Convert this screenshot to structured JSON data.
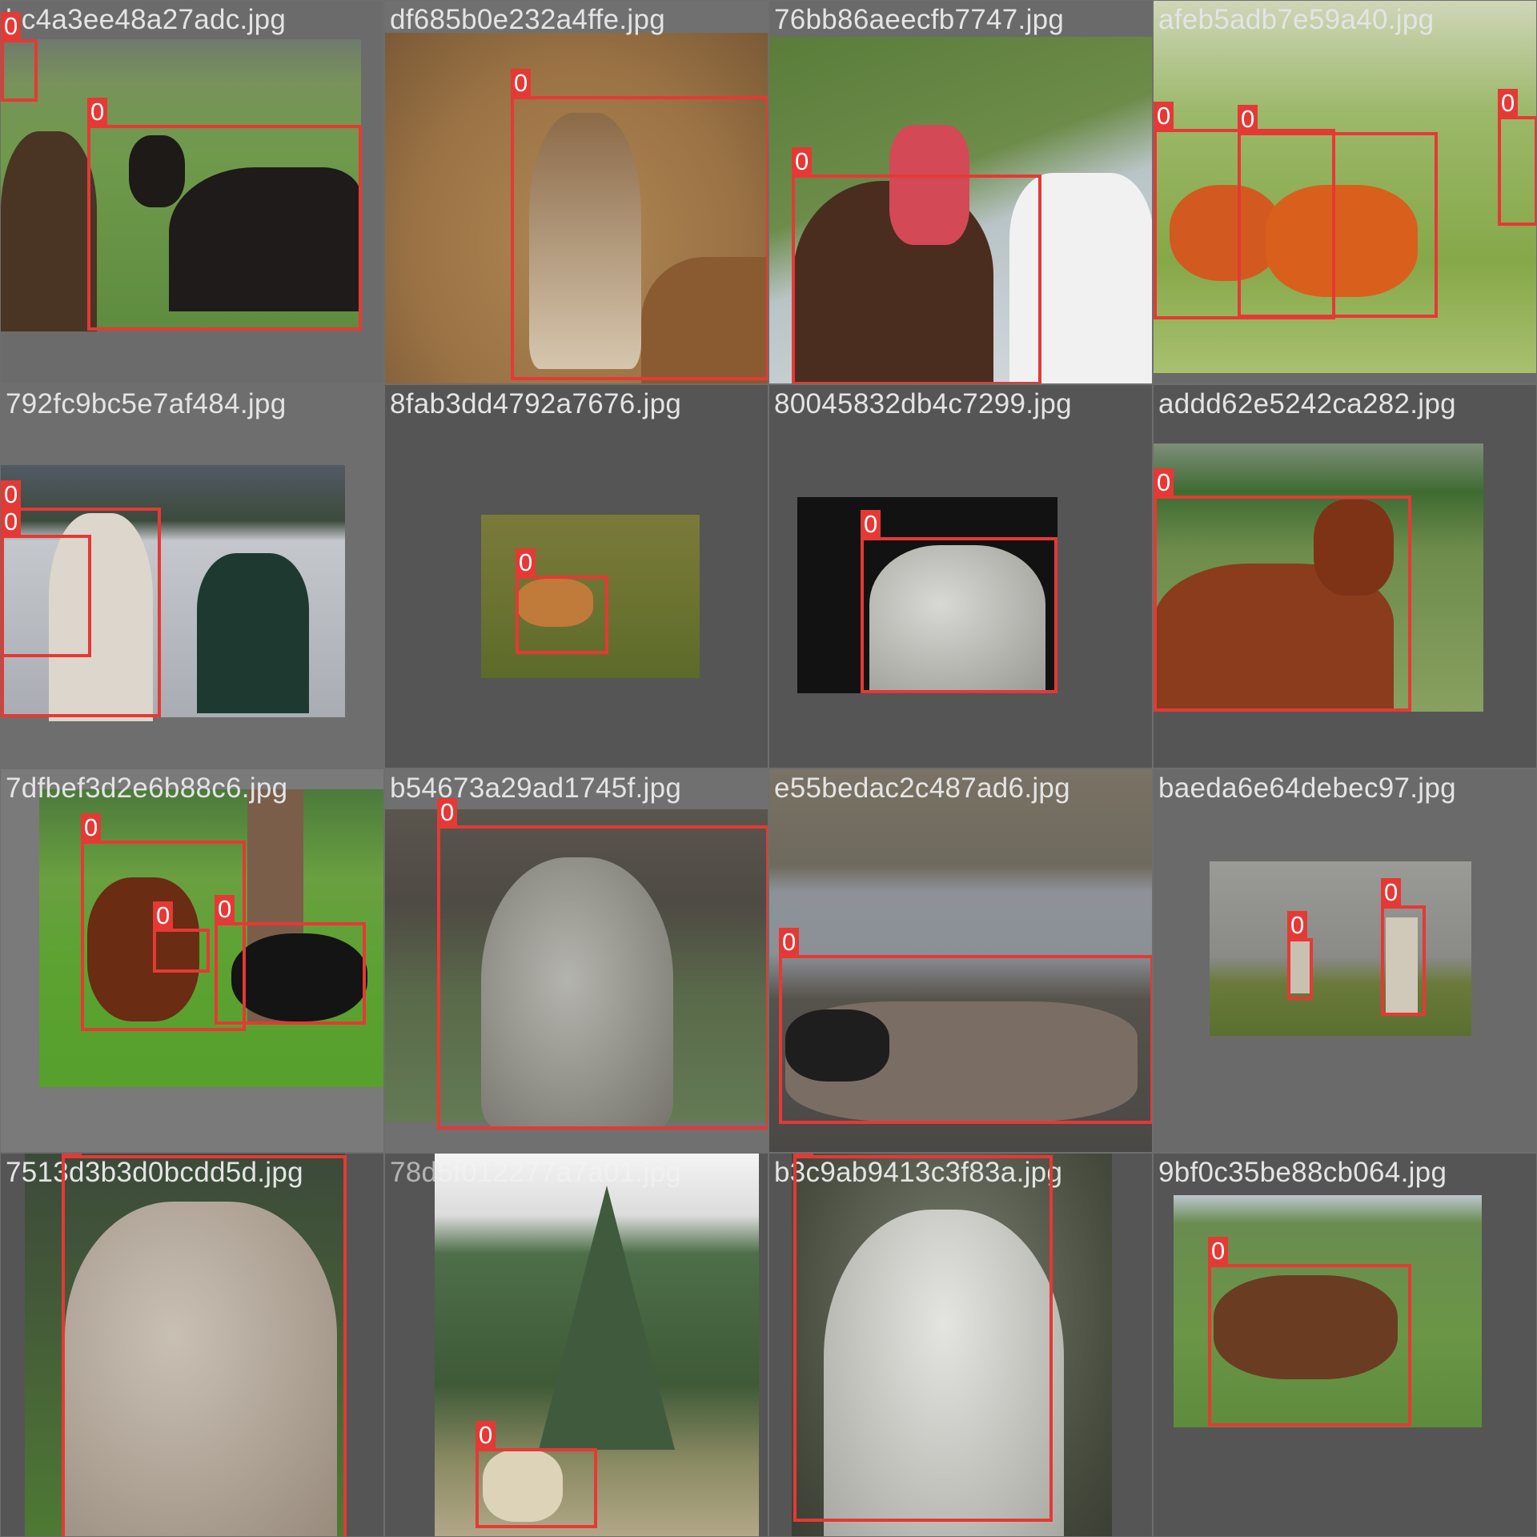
{
  "colors": {
    "box": "#e53935",
    "label_text": "#ffffff",
    "filename_text": "#e4e4e4"
  },
  "tiles": [
    {
      "filename": "bc4a3ee48a27adc.jpg",
      "scene": "two dark alpacas on green grass behind a wire fence",
      "labels": [
        "0",
        "0"
      ]
    },
    {
      "filename": "df685b0e232a4ffe.jpg",
      "scene": "brown guanaco lying on sandy ground",
      "labels": [
        "0"
      ]
    },
    {
      "filename": "76bb86aeecfb7747.jpg",
      "scene": "two boys in caps posing with a brown alpaca",
      "labels": [
        "0"
      ]
    },
    {
      "filename": "afeb5adb7e59a40.jpg",
      "scene": "orange vicuñas among shrubs",
      "labels": [
        "0",
        "0",
        "0"
      ]
    },
    {
      "filename": "792fc9bc5e7af484.jpg",
      "scene": "white llama led by a person by a frozen lake",
      "labels": [
        "0",
        "0"
      ]
    },
    {
      "filename": "8fab3dd4792a7676.jpg",
      "scene": "small guanaco grazing in a field",
      "labels": [
        "0"
      ]
    },
    {
      "filename": "80045832db4c7299.jpg",
      "scene": "white alpaca on a dark background",
      "labels": [
        "0"
      ]
    },
    {
      "filename": "addd62e5242ca282.jpg",
      "scene": "brown alpaca leaning over a metal gate",
      "labels": [
        "0"
      ]
    },
    {
      "filename": "7dfbef3d2e6b88c6.jpg",
      "scene": "brown and black alpacas by a tree on bright grass",
      "labels": [
        "0",
        "0",
        "0"
      ]
    },
    {
      "filename": "b54673a29ad1745f.jpg",
      "scene": "grey alpaca close-up near a wooden fence",
      "labels": [
        "0"
      ]
    },
    {
      "filename": "e55bedac2c487ad6.jpg",
      "scene": "herd of pack llamas beside a lake in the mountains",
      "labels": [
        "0"
      ]
    },
    {
      "filename": "baeda6e64debec97.jpg",
      "scene": "two pale alpacas next to a stone wall",
      "labels": [
        "0",
        "0"
      ]
    },
    {
      "filename": "7513d3b3d0bcdd5d.jpg",
      "scene": "haltered llama head close-up",
      "labels": [
        "0"
      ]
    },
    {
      "filename": "78d5f012277a7a01.jpg",
      "scene": "llama at Machu Picchu with mountain behind",
      "labels": [
        "0"
      ]
    },
    {
      "filename": "b3c9ab9413c3f83a.jpg",
      "scene": "white llama facing the camera",
      "labels": [
        "0"
      ]
    },
    {
      "filename": "9bf0c35be88cb064.jpg",
      "scene": "brown alpaca with halter on grass by the sea",
      "labels": [
        "0"
      ]
    }
  ]
}
